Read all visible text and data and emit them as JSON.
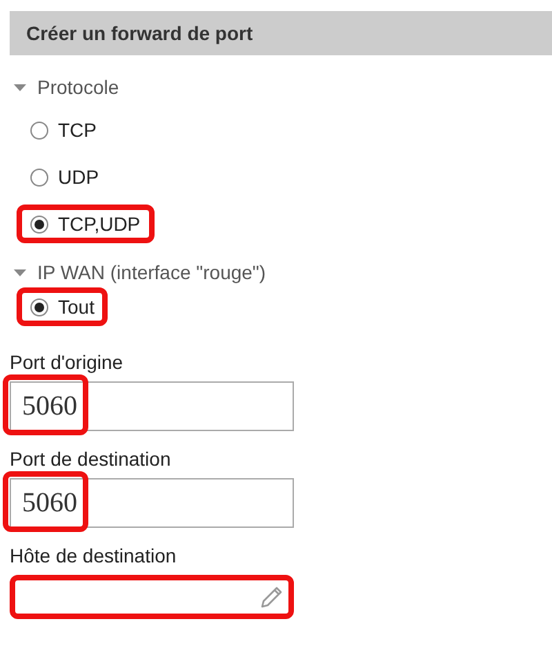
{
  "panel": {
    "title": "Créer un forward de port"
  },
  "sections": [
    {
      "label": "Protocole",
      "expanded": true,
      "options": [
        {
          "label": "TCP",
          "selected": false,
          "highlighted": false
        },
        {
          "label": "UDP",
          "selected": false,
          "highlighted": false
        },
        {
          "label": "TCP,UDP",
          "selected": true,
          "highlighted": true
        }
      ]
    },
    {
      "label": "IP WAN (interface \"rouge\")",
      "expanded": true,
      "options": [
        {
          "label": "Tout",
          "selected": true,
          "highlighted": true
        }
      ]
    }
  ],
  "fields": [
    {
      "kind": "text",
      "label": "Port d'origine",
      "value": "5060",
      "highlighted": true
    },
    {
      "kind": "text",
      "label": "Port de destination",
      "value": "5060",
      "highlighted": true
    },
    {
      "kind": "edit",
      "label": "Hôte de destination",
      "highlighted": true
    }
  ]
}
